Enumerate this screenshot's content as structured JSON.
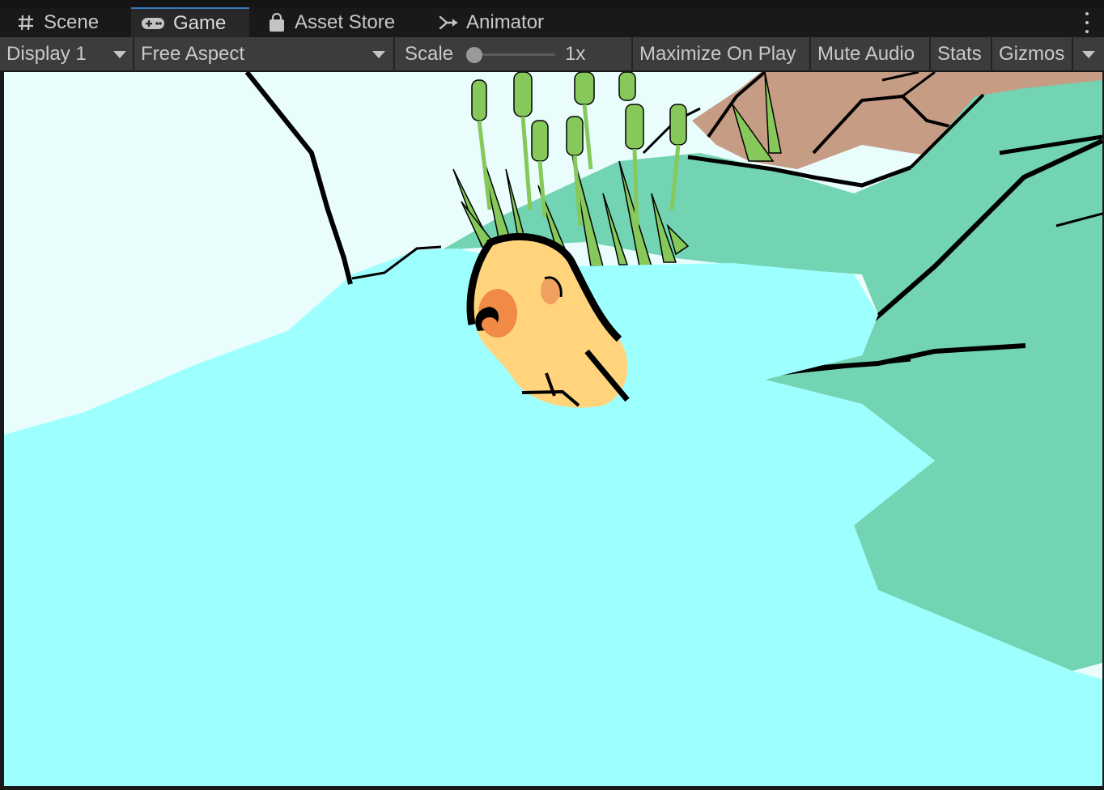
{
  "tabs": [
    {
      "label": "Scene",
      "icon": "grid-hash-icon",
      "active": false
    },
    {
      "label": "Game",
      "icon": "gamepad-icon",
      "active": true
    },
    {
      "label": "Asset Store",
      "icon": "shopping-bag-icon",
      "active": false
    },
    {
      "label": "Animator",
      "icon": "animator-branch-icon",
      "active": false
    }
  ],
  "toolbar": {
    "display": "Display 1",
    "aspect": "Free Aspect",
    "scale_label": "Scale",
    "scale_value": "1x",
    "scale_fraction": 0.0,
    "maximize": "Maximize On Play",
    "mute": "Mute Audio",
    "stats": "Stats",
    "gizmos": "Gizmos"
  },
  "colors": {
    "water": "#9effff",
    "sky": "#eafdfd",
    "grass_bank": "#72d4b2",
    "rock": "#c79c84",
    "reeds": "#86c95a",
    "duck_body": "#ffd47c",
    "duck_beak": "#f08a45",
    "outline": "#000000",
    "tab_accent": "#3a79bb"
  }
}
